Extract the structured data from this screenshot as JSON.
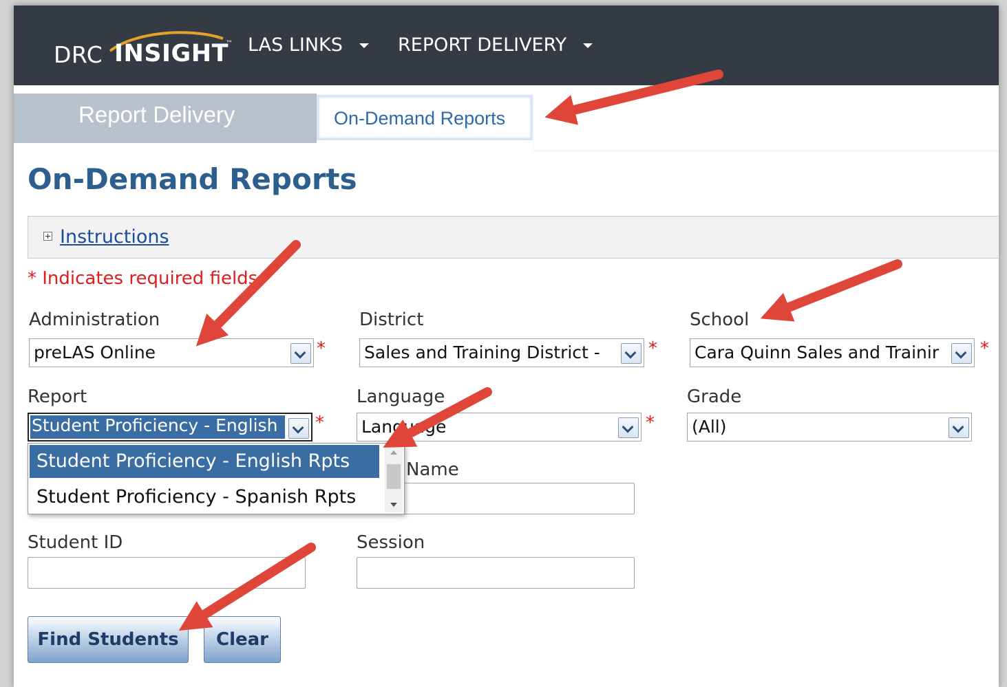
{
  "header": {
    "logo_drc": "DRC",
    "logo_insight": "INSIGHT",
    "logo_tm": "™",
    "menu_las_links": "LAS LINKS",
    "menu_report_delivery": "REPORT DELIVERY"
  },
  "tabs": {
    "report_delivery": "Report Delivery",
    "on_demand_reports": "On-Demand Reports"
  },
  "page": {
    "title": "On-Demand Reports",
    "instructions_link": "Instructions",
    "required_note": "* Indicates required fields"
  },
  "form": {
    "administration": {
      "label": "Administration",
      "value": "preLAS Online"
    },
    "district": {
      "label": "District",
      "value": "Sales and Training District - "
    },
    "school": {
      "label": "School",
      "value": "Cara Quinn Sales and Trainir"
    },
    "report": {
      "label": "Report",
      "value": "Student Proficiency - English",
      "options": [
        "Student Proficiency - English Rpts",
        "Student Proficiency - Spanish Rpts"
      ]
    },
    "language": {
      "label": "Language",
      "value": "Language"
    },
    "grade": {
      "label": "Grade",
      "value": "(All)"
    },
    "name": {
      "label": "Name"
    },
    "student_id": {
      "label": "Student ID"
    },
    "session": {
      "label": "Session"
    },
    "required_marker": "*"
  },
  "buttons": {
    "find_students": "Find Students",
    "clear": "Clear"
  },
  "colors": {
    "nav_bg": "#353b45",
    "title_blue": "#2d5f8e",
    "required_red": "#e11c1c",
    "annotation_arrow": "#e0453a",
    "selected_option": "#3a6da4"
  }
}
